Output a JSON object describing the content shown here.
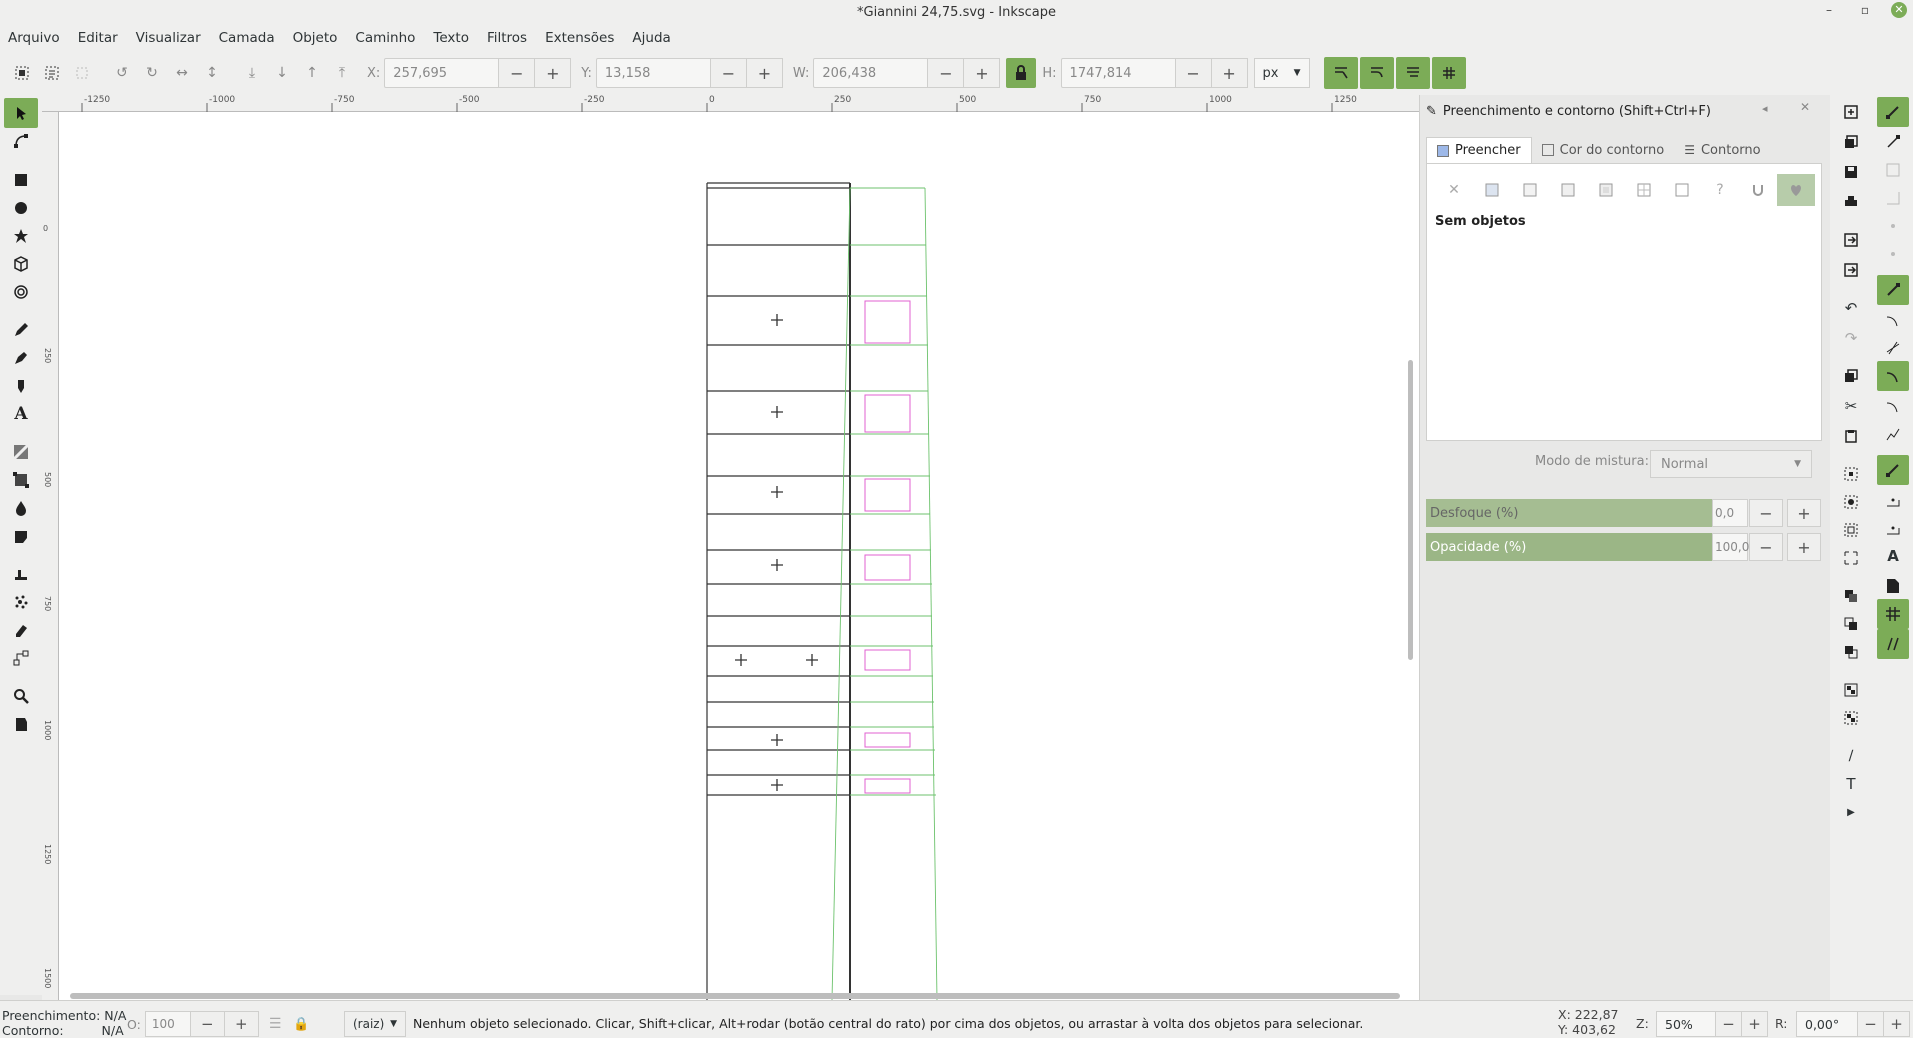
{
  "window": {
    "title": "*Giannini 24,75.svg - Inkscape",
    "minimize": "–",
    "maximize": "▫",
    "close": "✕"
  },
  "menu": [
    "Arquivo",
    "Editar",
    "Visualizar",
    "Camada",
    "Objeto",
    "Caminho",
    "Texto",
    "Filtros",
    "Extensões",
    "Ajuda"
  ],
  "toolbar": {
    "x_label": "X:",
    "x_value": "257,695",
    "y_label": "Y:",
    "y_value": "13,158",
    "w_label": "W:",
    "w_value": "206,438",
    "h_label": "H:",
    "h_value": "1747,814",
    "unit": "px",
    "minus": "−",
    "plus": "+"
  },
  "ruler": {
    "h_ticks": [
      "-1250",
      "-1000",
      "-750",
      "-500",
      "-250",
      "0",
      "250",
      "500",
      "750",
      "1000",
      "1250"
    ],
    "v_ticks": [
      "0",
      "250",
      "500",
      "750",
      "1000",
      "1250",
      "1500"
    ]
  },
  "panel": {
    "title": "Preenchimento e contorno (Shift+Ctrl+F)",
    "tabs": [
      "Preencher",
      "Cor do contorno",
      "Contorno"
    ],
    "paint_none": "✕",
    "paint_unset": "?",
    "no_objects": "Sem objetos",
    "blend_label": "Modo de mistura:",
    "blend_value": "Normal",
    "blur_label": "Desfoque (%)",
    "blur_value": "0,0",
    "opacity_label": "Opacidade (%)",
    "opacity_value": "100,0"
  },
  "status": {
    "fill_label": "Preenchimento:",
    "fill_value": "N/A",
    "stroke_label": "Contorno:",
    "stroke_value": "N/A",
    "o_label": "O:",
    "o_value": "100",
    "layer": "(raiz)",
    "message": "Nenhum objeto selecionado. Clicar, Shift+clicar, Alt+rodar (botão central do rato) por cima dos objetos, ou arrastar à volta dos objetos para selecionar.",
    "x_label": "X:",
    "x_value": "222,87",
    "y_label": "Y:",
    "y_value": "403,62",
    "zoom_label": "Z:",
    "zoom_value": "50%",
    "rot_label": "R:",
    "rot_value": "0,00°"
  },
  "colors": {
    "accent": "#7cac57",
    "guide_green": "#6cc26c",
    "rect_pink": "#e060d0"
  }
}
